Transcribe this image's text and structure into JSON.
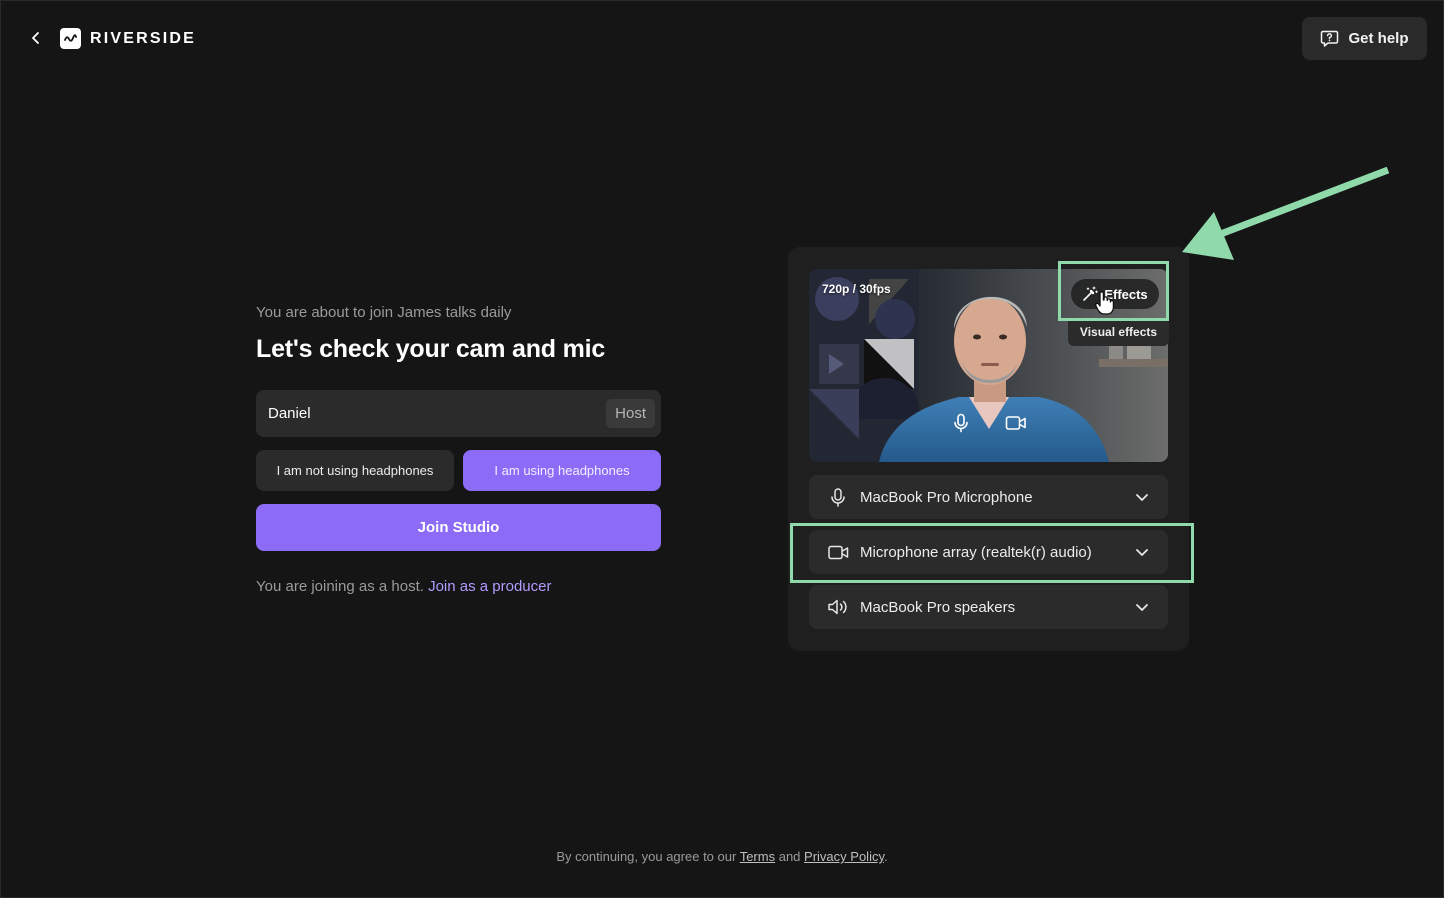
{
  "header": {
    "logo_text": "RIVERSIDE",
    "help_label": "Get help"
  },
  "form": {
    "subtitle": "You are about to join James talks daily",
    "title": "Let's check your cam and mic",
    "name_value": "Daniel",
    "role_badge": "Host",
    "headphones_off_label": "I am not using headphones",
    "headphones_on_label": "I am using headphones",
    "join_label": "Join Studio",
    "join_note": "You are joining as a host.",
    "producer_link": "Join as a producer"
  },
  "preview": {
    "resolution": "720p / 30fps",
    "effects_label": "Effects",
    "effects_tooltip": "Visual effects"
  },
  "devices": [
    {
      "icon": "microphone-icon",
      "label": "MacBook Pro Microphone"
    },
    {
      "icon": "camera-icon",
      "label": "Microphone array (realtek(r) audio)"
    },
    {
      "icon": "speaker-icon",
      "label": "MacBook Pro speakers"
    }
  ],
  "footer": {
    "prefix": "By continuing, you agree to our",
    "terms": "Terms",
    "and": "and",
    "privacy": "Privacy Policy",
    "suffix": "."
  },
  "colors": {
    "background": "#151515",
    "accent": "#8c6bf7",
    "highlight": "#8fd9ab"
  }
}
